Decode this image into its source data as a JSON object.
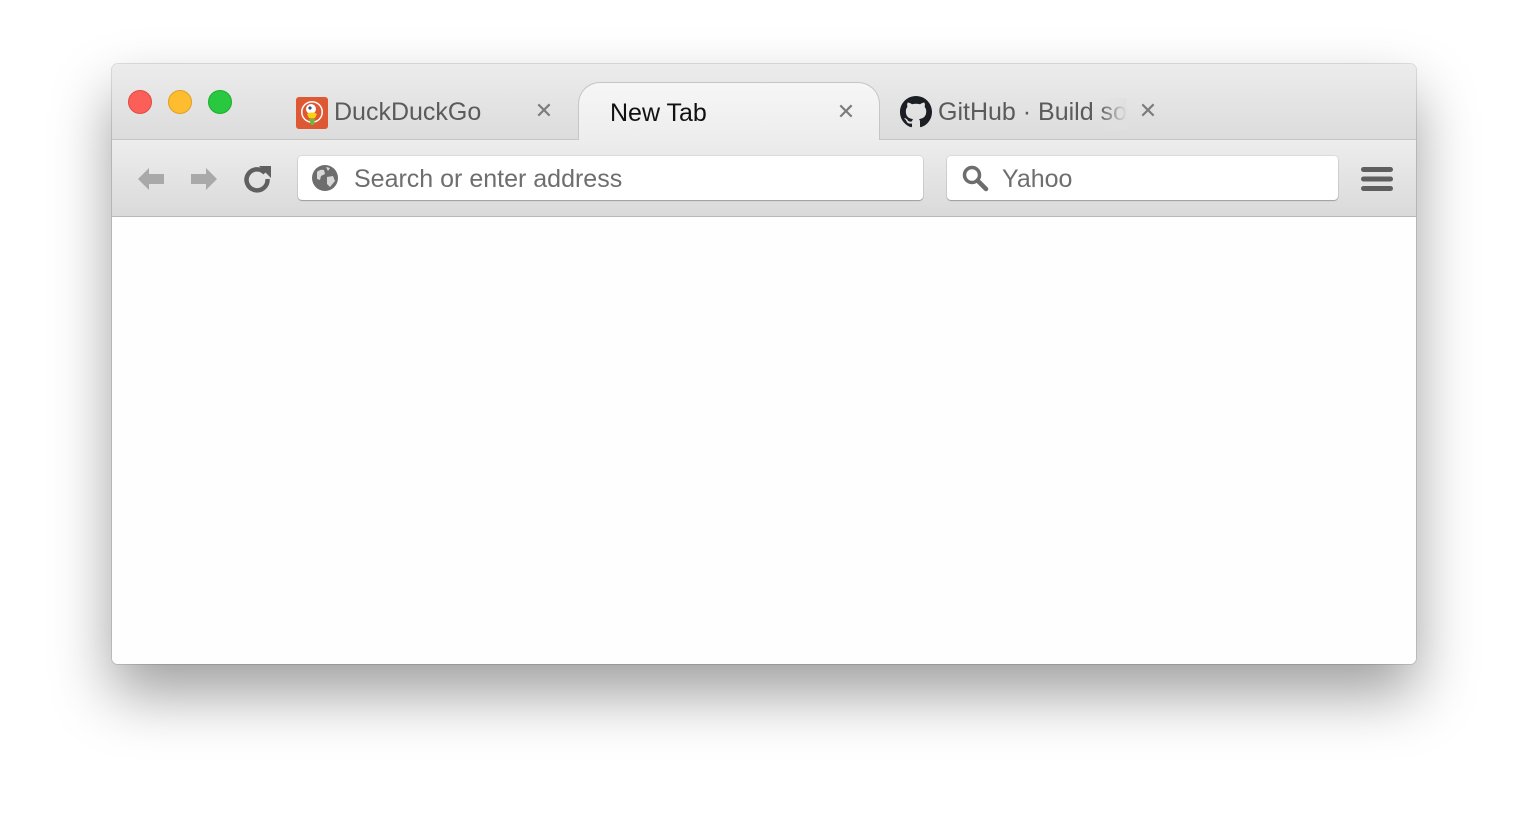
{
  "window": {
    "controls": [
      "close",
      "minimize",
      "maximize"
    ]
  },
  "tabs": [
    {
      "title": "DuckDuckGo",
      "icon": "duckduckgo-icon",
      "active": false
    },
    {
      "title": "New Tab",
      "icon": "",
      "active": true
    },
    {
      "title": "GitHub · Build so",
      "icon": "github-icon",
      "active": false
    }
  ],
  "toolbar": {
    "back_icon": "arrow-left-icon",
    "forward_icon": "arrow-right-icon",
    "reload_icon": "reload-icon",
    "menu_icon": "hamburger-menu-icon"
  },
  "address_bar": {
    "placeholder": "Search or enter address",
    "icon": "globe-icon"
  },
  "search_bar": {
    "placeholder": "Yahoo",
    "icon": "magnifier-icon"
  },
  "colors": {
    "traffic_close": "#fc5f57",
    "traffic_minimize": "#fdbd2e",
    "traffic_maximize": "#28c840",
    "duckduckgo_orange": "#de5833"
  }
}
